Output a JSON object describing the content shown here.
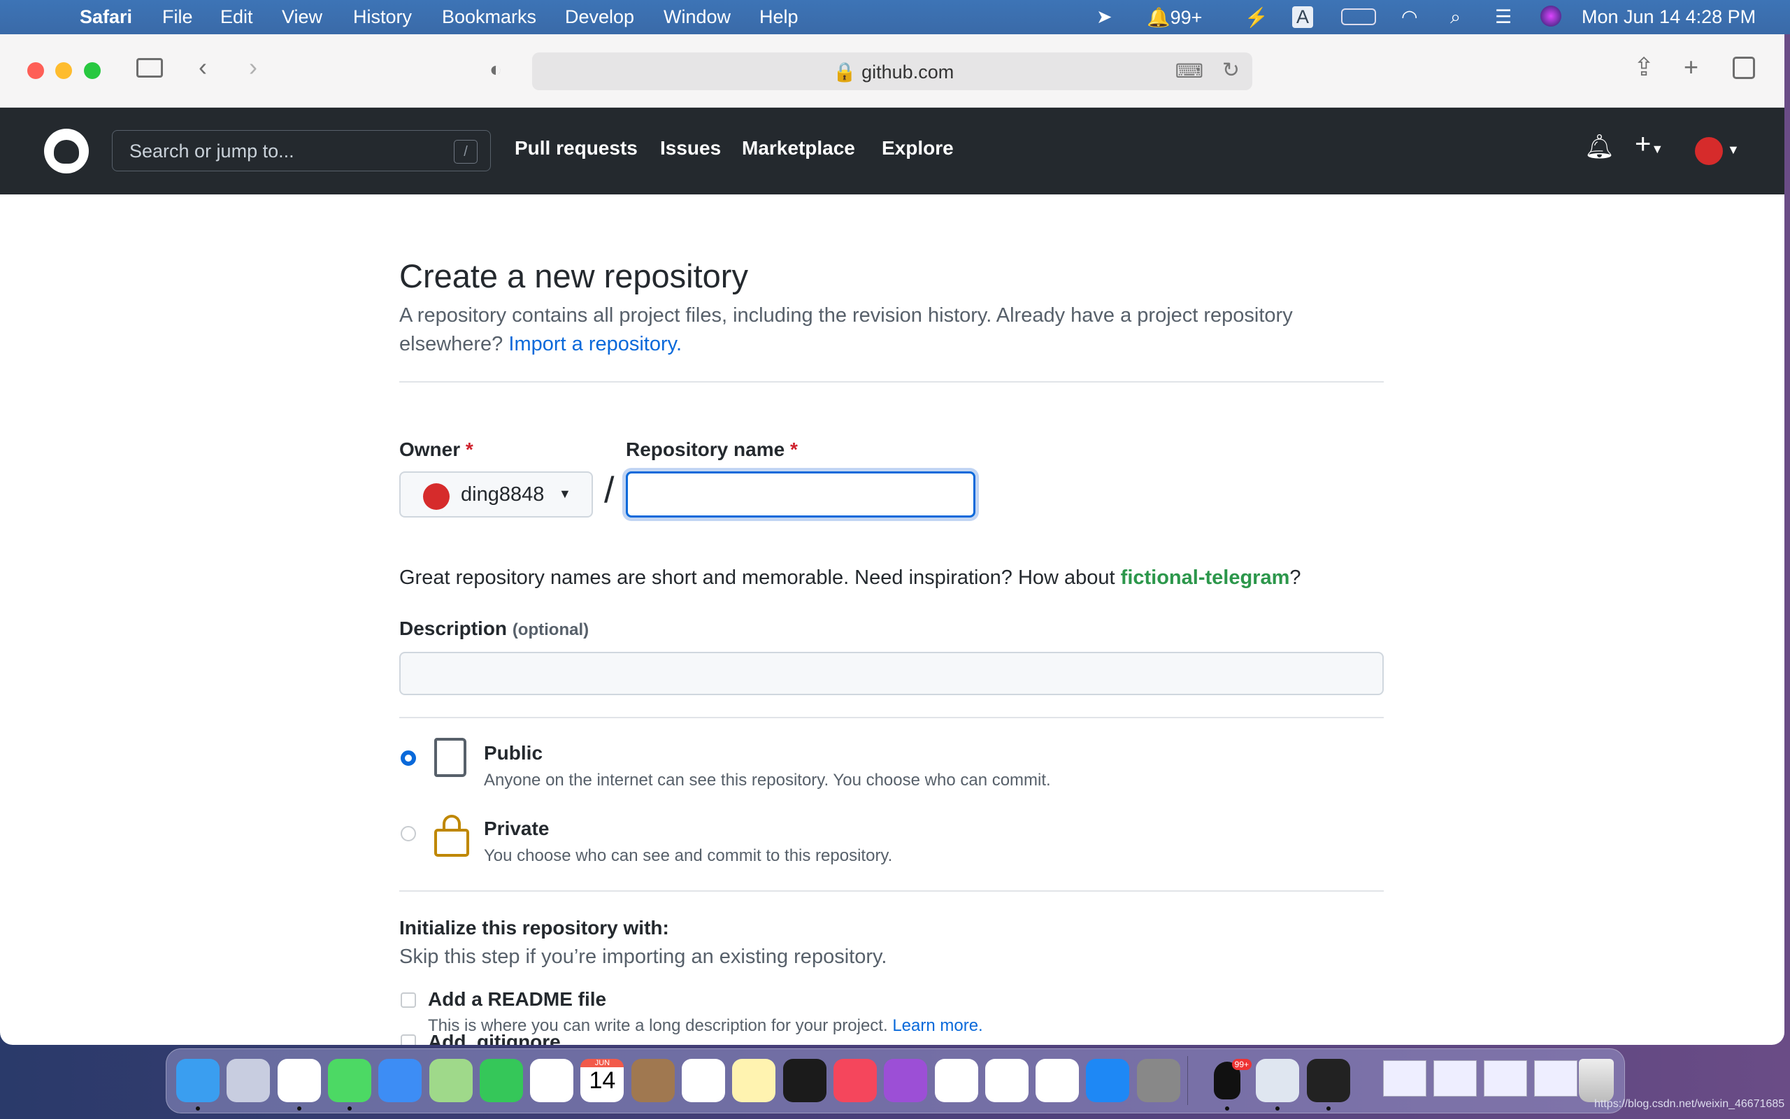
{
  "menubar": {
    "app": "Safari",
    "items": [
      "File",
      "Edit",
      "View",
      "History",
      "Bookmarks",
      "Develop",
      "Window",
      "Help"
    ],
    "notif_count": "99+",
    "input_indicator": "A",
    "clock": "Mon Jun 14  4:28 PM"
  },
  "browser": {
    "url": "github.com"
  },
  "github": {
    "search_placeholder": "Search or jump to...",
    "search_key": "/",
    "nav": [
      "Pull requests",
      "Issues",
      "Marketplace",
      "Explore"
    ]
  },
  "page": {
    "title": "Create a new repository",
    "subtitle_line1": "A repository contains all project files, including the revision history. Already have a project repository",
    "subtitle_line2": "elsewhere?",
    "import_link": "Import a repository.",
    "owner_label": "Owner",
    "required_mark": "*",
    "owner_value": "ding8848",
    "repo_name_label": "Repository name",
    "repo_name_value": "",
    "hint_text": "Great repository names are short and memorable. Need inspiration? How about",
    "hint_suggestion": "fictional-telegram",
    "hint_end": "?",
    "description_label": "Description",
    "description_optional": "(optional)",
    "description_value": "",
    "visibility": [
      {
        "label": "Public",
        "desc": "Anyone on the internet can see this repository. You choose who can commit.",
        "selected": true
      },
      {
        "label": "Private",
        "desc": "You choose who can see and commit to this repository.",
        "selected": false
      }
    ],
    "init_title": "Initialize this repository with:",
    "init_subtitle": "Skip this step if you’re importing an existing repository.",
    "readme_label": "Add a README file",
    "readme_checked": false,
    "readme_desc": "This is where you can write a long description for your project.",
    "learn_more": "Learn more.",
    "gitignore_label": "Add .gitignore"
  },
  "dock": {
    "calendar_month": "JUN",
    "calendar_day": "14",
    "qq_badge": "99+",
    "apps": [
      "finder",
      "launchpad",
      "safari",
      "messages",
      "mail",
      "maps",
      "facetime",
      "photos",
      "calendar",
      "contacts",
      "reminders",
      "notes",
      "tv",
      "music",
      "podcasts",
      "keynote",
      "numbers",
      "pages",
      "app-store",
      "system-preferences",
      "qq",
      "preview",
      "terminal"
    ]
  },
  "watermark": "https://blog.csdn.net/weixin_46671685",
  "colors": {
    "accent": "#0969da",
    "suggestion": "#2c974b",
    "header": "#24292e",
    "required": "#cf222e"
  }
}
